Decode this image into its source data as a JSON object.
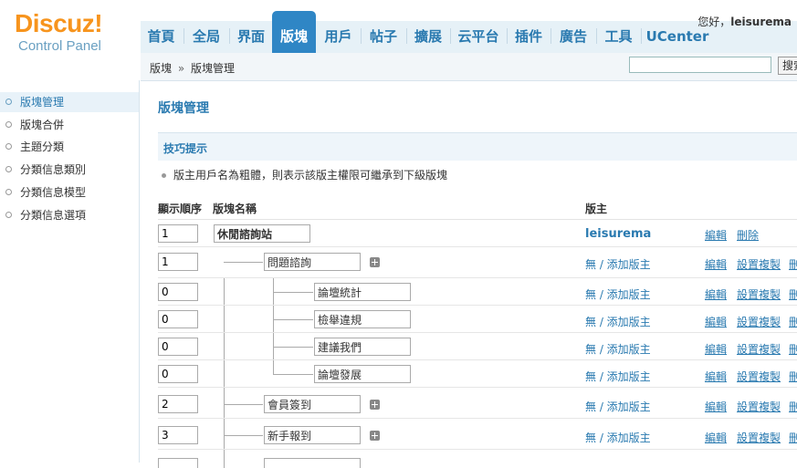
{
  "logo": {
    "title": "Discuz!",
    "subtitle": "Control Panel"
  },
  "nav": {
    "items": [
      "首頁",
      "全局",
      "界面",
      "版塊",
      "用戶",
      "帖子",
      "擴展",
      "云平台",
      "插件",
      "廣告",
      "工具",
      "UCenter"
    ],
    "active": "版塊"
  },
  "user": {
    "greeting": "您好，",
    "name": "leisurema"
  },
  "breadcrumb": {
    "root": "版塊",
    "arrow": "»",
    "current": "版塊管理"
  },
  "search": {
    "value": "",
    "button": "搜索"
  },
  "sidebar": {
    "items": [
      "版塊管理",
      "版塊合併",
      "主題分類",
      "分類信息類別",
      "分類信息模型",
      "分類信息選項"
    ],
    "active": "版塊管理"
  },
  "main": {
    "title": "版塊管理",
    "tips_title": "技巧提示",
    "tip": "版主用戶名為粗體，則表示該版主權限可繼承到下級版塊",
    "columns": {
      "order": "顯示順序",
      "name": "版塊名稱",
      "moderator": "版主"
    },
    "rows": [
      {
        "order": "1",
        "name": "休閒諮詢站",
        "moderator": "leisurema",
        "edit": "編輯",
        "action2": "刪除",
        "action3": ""
      },
      {
        "order": "1",
        "name": "問題諮詢",
        "moderator": "無 / 添加版主",
        "edit": "編輯",
        "action2": "設置複製",
        "action3": "刪"
      },
      {
        "order": "0",
        "name": "論壇統計",
        "moderator": "無 / 添加版主",
        "edit": "編輯",
        "action2": "設置複製",
        "action3": "刪"
      },
      {
        "order": "0",
        "name": "檢舉違規",
        "moderator": "無 / 添加版主",
        "edit": "編輯",
        "action2": "設置複製",
        "action3": "刪"
      },
      {
        "order": "0",
        "name": "建議我們",
        "moderator": "無 / 添加版主",
        "edit": "編輯",
        "action2": "設置複製",
        "action3": "刪"
      },
      {
        "order": "0",
        "name": "論壇發展",
        "moderator": "無 / 添加版主",
        "edit": "編輯",
        "action2": "設置複製",
        "action3": "刪"
      },
      {
        "order": "2",
        "name": "會員簽到",
        "moderator": "無 / 添加版主",
        "edit": "編輯",
        "action2": "設置複製",
        "action3": "刪"
      },
      {
        "order": "3",
        "name": "新手報到",
        "moderator": "無 / 添加版主",
        "edit": "編輯",
        "action2": "設置複製",
        "action3": "刪"
      }
    ]
  }
}
